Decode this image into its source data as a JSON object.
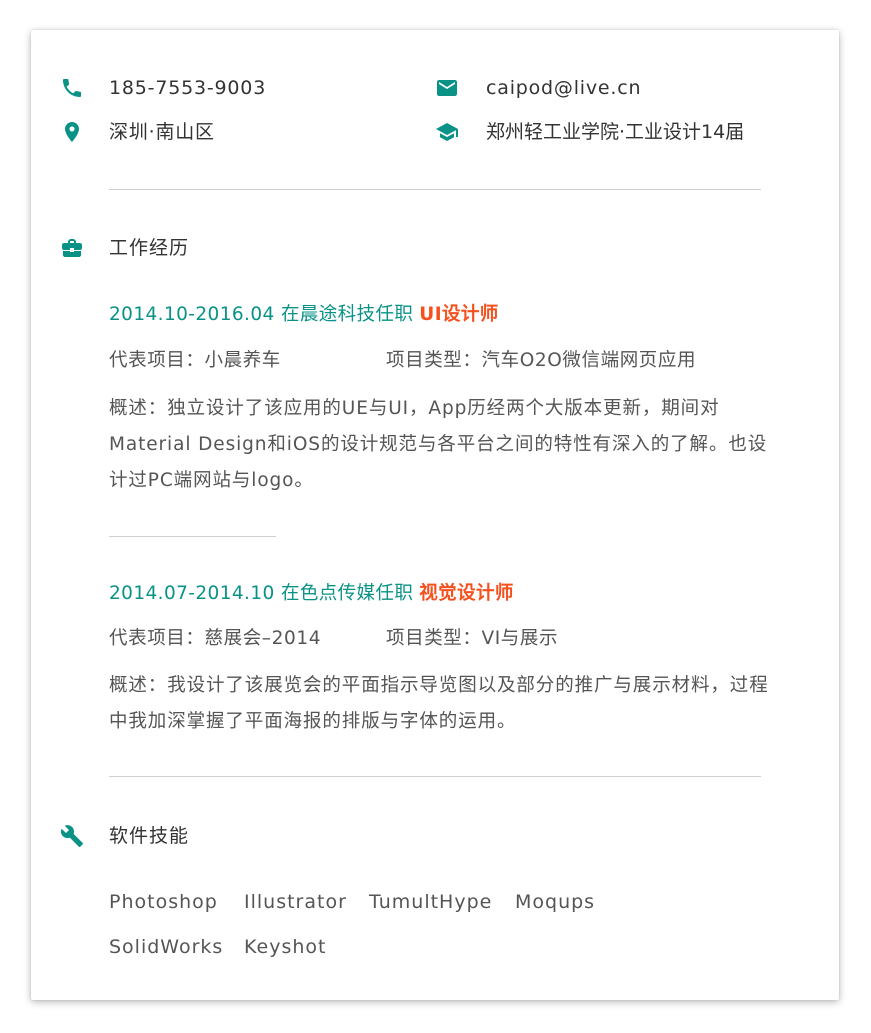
{
  "contact": {
    "phone": "185-7553-9003",
    "email": "caipod@live.cn",
    "location": "深圳·南山区",
    "education": "郑州轻工业学院·工业设计14届"
  },
  "work": {
    "title": "工作经历",
    "jobs": [
      {
        "header": "2014.10-2016.04 在晨途科技任职",
        "role": "UI设计师",
        "project": "代表项目：小晨养车",
        "type": "项目类型：汽车O2O微信端网页应用",
        "desc": "概述：独立设计了该应用的UE与UI，App历经两个大版本更新，期间对Material Design和iOS的设计规范与各平台之间的特性有深入的了解。也设计过PC端网站与logo。"
      },
      {
        "header": "2014.07-2014.10 在色点传媒任职",
        "role": "视觉设计师",
        "project": "代表项目：慈展会–2014",
        "type": "项目类型：VI与展示",
        "desc": "概述：我设计了该展览会的平面指示导览图以及部分的推广与展示材料，过程中我加深掌握了平面海报的排版与字体的运用。"
      }
    ]
  },
  "skills": {
    "title": "软件技能",
    "items": [
      "Photoshop",
      "Illustrator",
      "TumultHype",
      "Moqups",
      "SolidWorks",
      "Keyshot"
    ]
  },
  "colors": {
    "accent": "#0a9287",
    "role": "#f4511e"
  },
  "icons": [
    "phone-icon",
    "email-icon",
    "location-icon",
    "school-icon",
    "briefcase-icon",
    "wrench-icon"
  ]
}
